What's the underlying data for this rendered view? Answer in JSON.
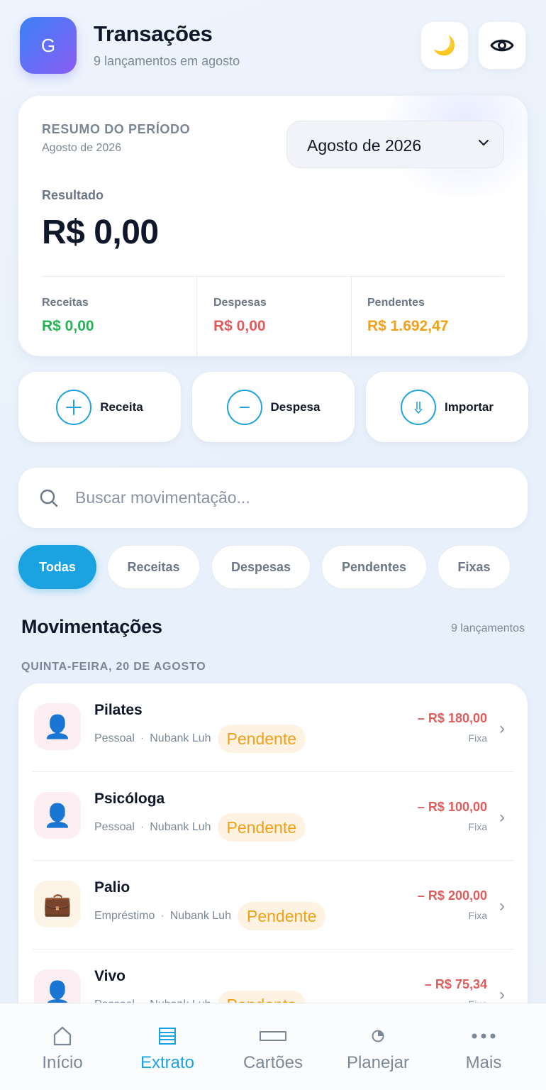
{
  "header": {
    "avatar_letter": "G",
    "title": "Transações",
    "subtitle": "9 lançamentos em agosto",
    "moon_glyph": "🌙",
    "moon_icon": "moon-icon",
    "eye_icon": "eye-icon"
  },
  "summary": {
    "label": "RESUMO DO PERÍODO",
    "period": "Agosto de 2026",
    "selected_period": "Agosto de 2026",
    "result_label": "Resultado",
    "result_value": "R$ 0,00",
    "income_label": "Receitas",
    "income_value": "R$ 0,00",
    "expense_label": "Despesas",
    "expense_value": "R$ 0,00",
    "pending_label": "Pendentes",
    "pending_value": "R$ 1.692,47",
    "colors": {
      "income": "#22b455",
      "expense": "#e25b5b",
      "pending": "#f0a019"
    }
  },
  "actions": [
    {
      "label": "Receita",
      "icon": "plus-circle-icon"
    },
    {
      "label": "Despesa",
      "icon": "minus-circle-icon"
    },
    {
      "label": "Importar",
      "icon": "import-arrow-icon"
    }
  ],
  "search": {
    "placeholder": "Buscar movimentação...",
    "value": ""
  },
  "filters": {
    "active": "Todas",
    "items": [
      "Todas",
      "Receitas",
      "Despesas",
      "Pendentes",
      "Fixas"
    ]
  },
  "section": {
    "title": "Movimentações",
    "count": "9 lançamentos",
    "date_heading": "QUINTA-FEIRA, 20 DE AGOSTO"
  },
  "transactions": [
    {
      "name": "Pilates",
      "category": "Pessoal",
      "account": "Nubank Luh",
      "status": "Pendente",
      "amount": "– R$ 180,00",
      "kind": "Fixa",
      "icon": "person-icon",
      "glyph": "👤"
    },
    {
      "name": "Psicóloga",
      "category": "Pessoal",
      "account": "Nubank Luh",
      "status": "Pendente",
      "amount": "– R$ 100,00",
      "kind": "Fixa",
      "icon": "person-icon",
      "glyph": "👤"
    },
    {
      "name": "Palio",
      "category": "Empréstimo",
      "account": "Nubank Luh",
      "status": "Pendente",
      "amount": "– R$ 200,00",
      "kind": "Fixa",
      "icon": "briefcase-icon",
      "glyph": "💼"
    },
    {
      "name": "Vivo",
      "category": "Pessoal",
      "account": "Nubank Luh",
      "status": "Pendente",
      "amount": "– R$ 75,34",
      "kind": "Fixa",
      "icon": "person-icon",
      "glyph": "👤"
    }
  ],
  "nav": {
    "active": "Extrato",
    "items": [
      {
        "label": "Início",
        "icon": "home-icon"
      },
      {
        "label": "Extrato",
        "icon": "statement-icon"
      },
      {
        "label": "Cartões",
        "icon": "card-icon"
      },
      {
        "label": "Planejar",
        "icon": "pie-chart-icon"
      },
      {
        "label": "Mais",
        "icon": "more-dots-icon"
      }
    ]
  },
  "accent_color": "#1aa3e0"
}
